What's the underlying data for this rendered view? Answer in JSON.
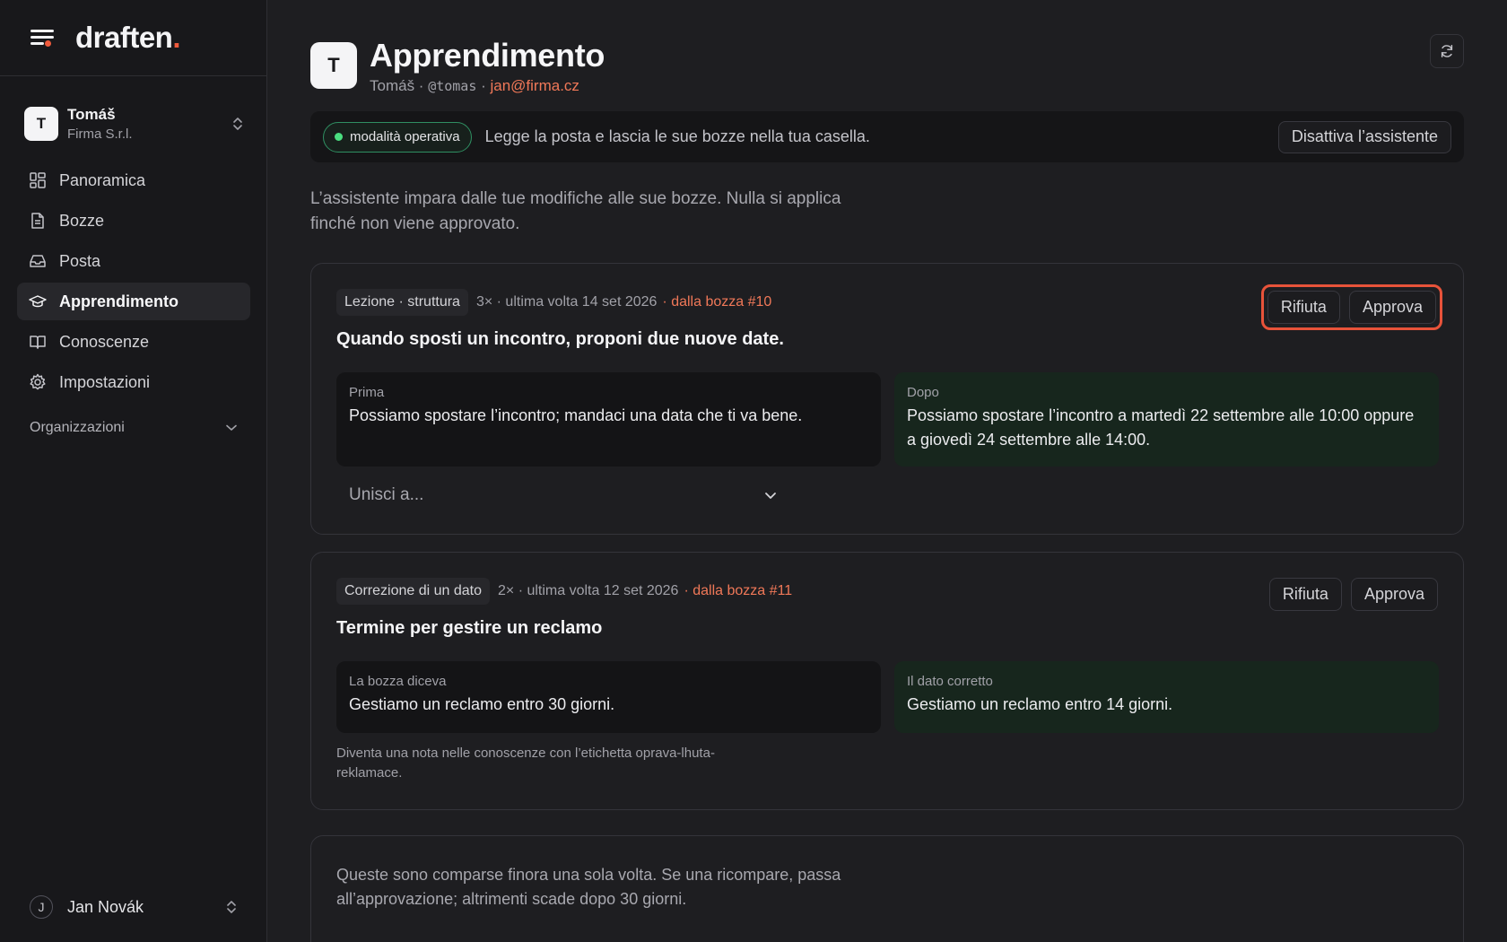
{
  "brand": {
    "name": "draften",
    "dot": "."
  },
  "account": {
    "initial": "T",
    "name": "Tomáš",
    "org": "Firma S.r.l."
  },
  "nav": {
    "items": [
      {
        "label": "Panoramica",
        "icon": "grid-icon"
      },
      {
        "label": "Bozze",
        "icon": "document-icon"
      },
      {
        "label": "Posta",
        "icon": "inbox-icon"
      },
      {
        "label": "Apprendimento",
        "icon": "graduation-cap-icon",
        "active": true
      },
      {
        "label": "Conoscenze",
        "icon": "book-icon"
      },
      {
        "label": "Impostazioni",
        "icon": "gear-icon"
      }
    ],
    "group_label": "Organizzazioni"
  },
  "user": {
    "initial": "J",
    "name": "Jan Novák"
  },
  "page": {
    "initial": "T",
    "title": "Apprendimento",
    "sub_name": "Tomáš",
    "sub_handle": "@tomas",
    "sub_email": "jan@firma.cz",
    "sep": " · "
  },
  "status": {
    "pill": "modalità operativa",
    "text": "Legge la posta e lascia le sue bozze nella tua casella.",
    "disable_button": "Disattiva l’assistente"
  },
  "intro": "L’assistente impara dalle tue modifiche alle sue bozze. Nulla si applica finché non viene approvato.",
  "cards": [
    {
      "tag": "Lezione · struttura",
      "count": "3×",
      "last": "· ultima volta 14 set 2026",
      "source": "· dalla bozza #10",
      "title": "Quando sposti un incontro, proponi due nuove date.",
      "reject": "Rifiuta",
      "approve": "Approva",
      "before_label": "Prima",
      "before_text": "Possiamo spostare l’incontro; mandaci una data che ti va bene.",
      "after_label": "Dopo",
      "after_text": "Possiamo spostare l’incontro a martedì 22 settembre alle 10:00 oppure a giovedì 24 settembre alle 14:00.",
      "merge_placeholder": "Unisci a..."
    },
    {
      "tag": "Correzione di un dato",
      "count": "2×",
      "last": "· ultima volta 12 set 2026",
      "source": "· dalla bozza #11",
      "title": "Termine per gestire un reclamo",
      "reject": "Rifiuta",
      "approve": "Approva",
      "before_label": "La bozza diceva",
      "before_text": "Gestiamo un reclamo entro 30 giorni.",
      "after_label": "Il dato corretto",
      "after_text": "Gestiamo un reclamo entro 14 giorni.",
      "note": "Diventa una nota nelle conoscenze con l’etichetta oprava-lhuta-reklamace."
    }
  ],
  "pending": {
    "intro": "Queste sono comparse finora una sola volta. Se una ricompare, passa all’approvazione; altrimenti scade dopo 30 giorni."
  },
  "colors": {
    "accent": "#ef5a3c",
    "link": "#f07858",
    "success": "#4ade80",
    "highlight": "#e8533a"
  }
}
